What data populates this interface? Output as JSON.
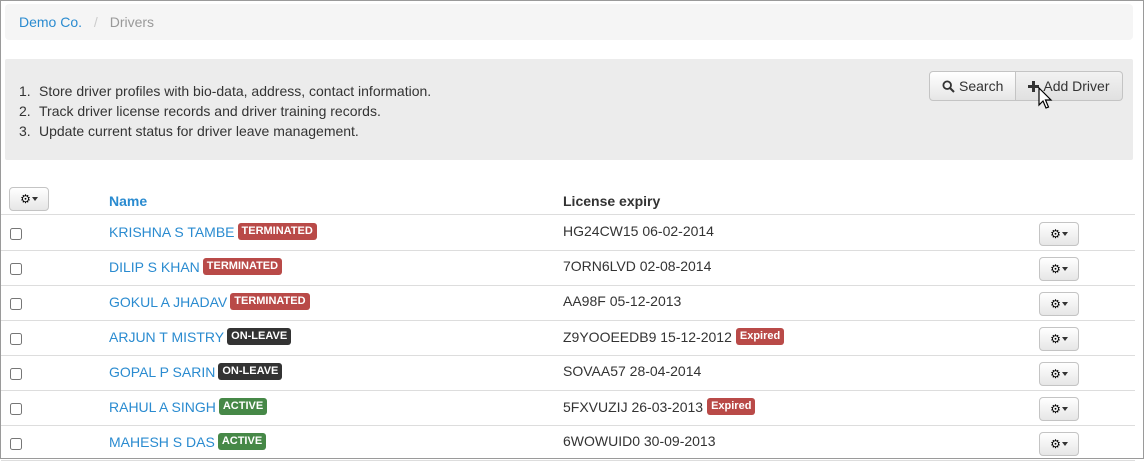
{
  "breadcrumb": {
    "home": "Demo Co.",
    "current": "Drivers"
  },
  "info": {
    "items": [
      {
        "num": "1.",
        "text": "Store driver profiles with bio-data, address, contact information."
      },
      {
        "num": "2.",
        "text": "Track driver license records and driver training records."
      },
      {
        "num": "3.",
        "text": "Update current status for driver leave management."
      }
    ]
  },
  "toolbar": {
    "search_label": "Search",
    "add_label": "Add Driver"
  },
  "table": {
    "columns": {
      "name": "Name",
      "license": "License expiry"
    },
    "rows": [
      {
        "name": "KRISHNA S TAMBE",
        "status": "TERMINATED",
        "license": "HG24CW15 06-02-2014",
        "expired": ""
      },
      {
        "name": "DILIP S KHAN",
        "status": "TERMINATED",
        "license": "7ORN6LVD 02-08-2014",
        "expired": ""
      },
      {
        "name": "GOKUL A JHADAV",
        "status": "TERMINATED",
        "license": "AA98F 05-12-2013",
        "expired": ""
      },
      {
        "name": "ARJUN T MISTRY",
        "status": "ON-LEAVE",
        "license": "Z9YOOEEDB9 15-12-2012",
        "expired": "Expired"
      },
      {
        "name": "GOPAL P SARIN",
        "status": "ON-LEAVE",
        "license": "SOVAA57 28-04-2014",
        "expired": ""
      },
      {
        "name": "RAHUL A SINGH",
        "status": "ACTIVE",
        "license": "5FXVUZIJ 26-03-2013",
        "expired": "Expired"
      },
      {
        "name": "MAHESH S DAS",
        "status": "ACTIVE",
        "license": "6WOWUID0 30-09-2013",
        "expired": ""
      }
    ]
  },
  "colors": {
    "link": "#2a8bd0",
    "terminated": "#b94a48",
    "on_leave": "#333333",
    "active": "#468847",
    "expired": "#b94a48"
  }
}
